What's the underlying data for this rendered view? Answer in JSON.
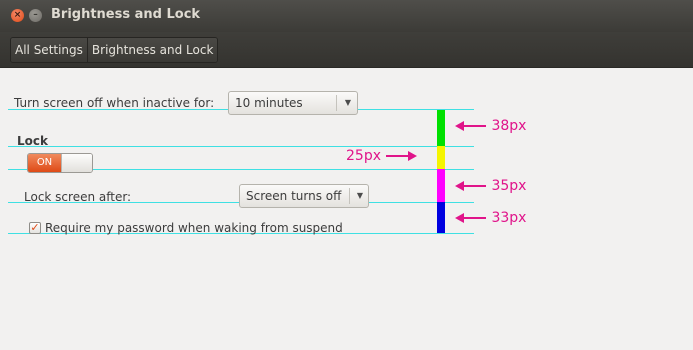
{
  "window": {
    "title": "Brightness and Lock",
    "close_glyph": "×",
    "minimize_glyph": "–"
  },
  "breadcrumb": {
    "items": [
      "All Settings",
      "Brightness and Lock"
    ]
  },
  "screen_off": {
    "label": "Turn screen off when inactive for:",
    "value": "10 minutes"
  },
  "lock": {
    "heading": "Lock",
    "toggle_label": "ON",
    "toggle_state": true,
    "lock_after_label": "Lock screen after:",
    "lock_after_value": "Screen turns off",
    "require_password_label": "Require my password when waking from suspend",
    "require_password_checked": true
  },
  "annotations": {
    "colors": [
      "#00e000",
      "#f5f500",
      "#ff00ff",
      "#0000e0"
    ],
    "guide_color": "#3fe0e3",
    "arrow_color": "#e0148a",
    "measures": [
      "38px",
      "25px",
      "35px",
      "33px"
    ]
  },
  "icons": {
    "checkmark": "✓",
    "dropdown_arrow": "▼"
  }
}
